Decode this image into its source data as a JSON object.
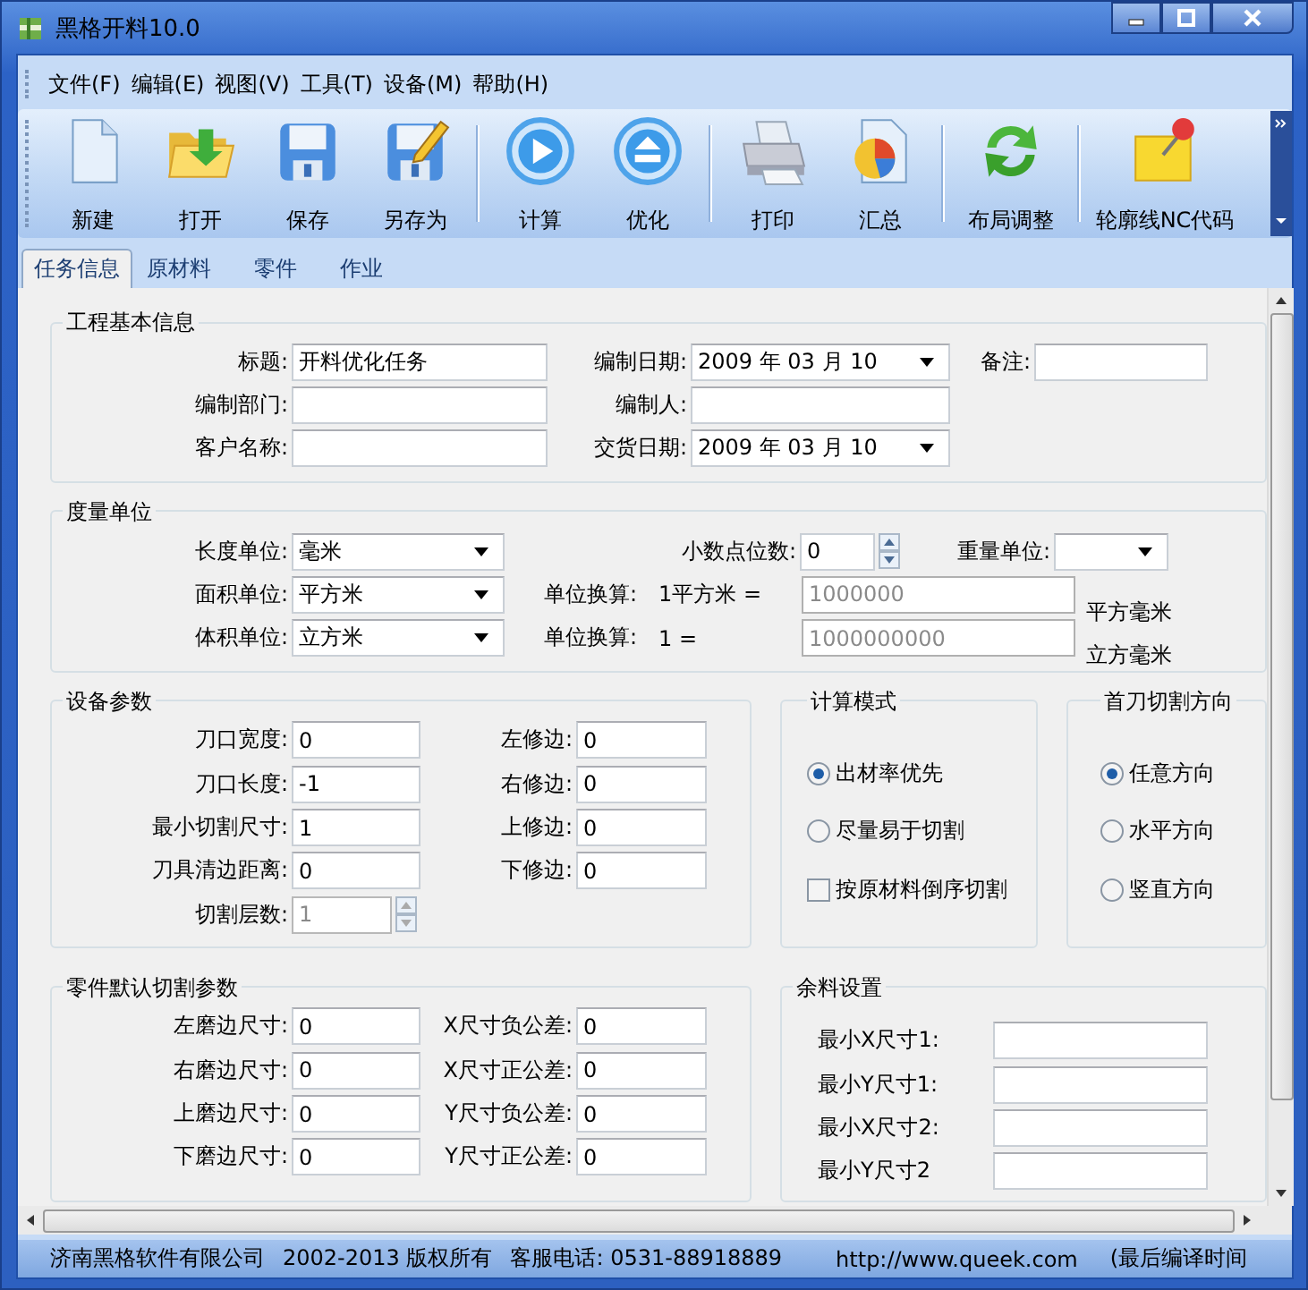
{
  "window": {
    "title": "黑格开料10.0"
  },
  "menu": [
    "文件(F)",
    "编辑(E)",
    "视图(V)",
    "工具(T)",
    "设备(M)",
    "帮助(H)"
  ],
  "toolbar": [
    [
      {
        "label": "新建",
        "kind": "new"
      },
      {
        "label": "打开",
        "kind": "open"
      },
      {
        "label": "保存",
        "kind": "save"
      },
      {
        "label": "另存为",
        "kind": "save_as"
      }
    ],
    [
      {
        "label": "计算",
        "kind": "calculate"
      },
      {
        "label": "优化",
        "kind": "optimize"
      }
    ],
    [
      {
        "label": "打印",
        "kind": "print"
      },
      {
        "label": "汇总",
        "kind": "summary"
      }
    ],
    [
      {
        "label": "布局调整",
        "kind": "layout"
      }
    ],
    [
      {
        "label": "轮廓线NC代码",
        "kind": "nc"
      }
    ]
  ],
  "tabs": [
    {
      "label": "任务信息",
      "selected": true
    },
    {
      "label": "原材料",
      "selected": false
    },
    {
      "label": "零件",
      "selected": false
    },
    {
      "label": "作业",
      "selected": false
    }
  ],
  "project_info": {
    "title": "工程基本信息",
    "rows": [
      [
        {
          "label": "标题:",
          "kind": "text",
          "value": "开料优化任务"
        },
        {
          "label": "编制日期:",
          "kind": "date",
          "value": "2009 年 03 月 10"
        },
        {
          "label": "备注:",
          "kind": "text"
        }
      ],
      [
        {
          "label": "编制部门:",
          "kind": "text"
        },
        {
          "label": "编制人:",
          "kind": "text"
        }
      ],
      [
        {
          "label": "客户名称:",
          "kind": "text"
        },
        {
          "label": "交货日期:",
          "kind": "date",
          "value": "2009 年 03 月 10"
        }
      ]
    ]
  },
  "units": {
    "title": "度量单位",
    "rows": [
      [
        {
          "label": "长度单位:",
          "kind": "select",
          "value": "毫米"
        },
        {
          "label": "小数点位数:",
          "kind": "spin",
          "value": "0",
          "disabled": false
        },
        {
          "label": "重量单位:",
          "kind": "select"
        }
      ],
      [
        {
          "label": "面积单位:",
          "kind": "select",
          "value": "平方米"
        },
        {
          "label": "单位换算:",
          "kind": "conversion",
          "prefix": "1平方米 =",
          "value": "1000000",
          "suffix": "平方毫米"
        }
      ],
      [
        {
          "label": "体积单位:",
          "kind": "select",
          "value": "立方米"
        },
        {
          "label": "单位换算:",
          "kind": "conversion",
          "prefix": "1 =",
          "value": "1000000000",
          "suffix": "立方毫米"
        }
      ]
    ]
  },
  "equipment": {
    "title": "设备参数",
    "rows": [
      [
        {
          "label": "刀口宽度:",
          "kind": "text",
          "value": "0"
        },
        {
          "label": "左修边:",
          "kind": "text",
          "value": "0"
        }
      ],
      [
        {
          "label": "刀口长度:",
          "kind": "text",
          "value": "-1"
        },
        {
          "label": "右修边:",
          "kind": "text",
          "value": "0"
        }
      ],
      [
        {
          "label": "最小切割尺寸:",
          "kind": "text",
          "value": "1"
        },
        {
          "label": "上修边:",
          "kind": "text",
          "value": "0"
        }
      ],
      [
        {
          "label": "刀具清边距离:",
          "kind": "text",
          "value": "0"
        },
        {
          "label": "下修边:",
          "kind": "text",
          "value": "0"
        }
      ],
      [
        {
          "label": "切割层数:",
          "kind": "spin",
          "value": "1",
          "disabled": true
        }
      ]
    ]
  },
  "calc_mode": {
    "title": "计算模式",
    "options": [
      {
        "label": "出材率优先",
        "kind": "radio",
        "selected": true
      },
      {
        "label": "尽量易于切割",
        "kind": "radio",
        "selected": false
      },
      {
        "label": "按原材料倒序切割",
        "kind": "checkbox",
        "checked": false
      }
    ]
  },
  "first_cut": {
    "title": "首刀切割方向",
    "options": [
      {
        "label": "任意方向",
        "kind": "radio",
        "selected": true
      },
      {
        "label": "水平方向",
        "kind": "radio",
        "selected": false
      },
      {
        "label": "竖直方向",
        "kind": "radio",
        "selected": false
      }
    ]
  },
  "part_defaults": {
    "title": "零件默认切割参数",
    "rows": [
      [
        {
          "label": "左磨边尺寸:",
          "kind": "text",
          "value": "0"
        },
        {
          "label": "X尺寸负公差:",
          "kind": "text",
          "value": "0"
        }
      ],
      [
        {
          "label": "右磨边尺寸:",
          "kind": "text",
          "value": "0"
        },
        {
          "label": "X尺寸正公差:",
          "kind": "text",
          "value": "0"
        }
      ],
      [
        {
          "label": "上磨边尺寸:",
          "kind": "text",
          "value": "0"
        },
        {
          "label": "Y尺寸负公差:",
          "kind": "text",
          "value": "0"
        }
      ],
      [
        {
          "label": "下磨边尺寸:",
          "kind": "text",
          "value": "0"
        },
        {
          "label": "Y尺寸正公差:",
          "kind": "text",
          "value": "0"
        }
      ]
    ]
  },
  "leftover": {
    "title": "余料设置",
    "rows": [
      [
        {
          "label": "最小X尺寸1:",
          "kind": "text"
        }
      ],
      [
        {
          "label": "最小Y尺寸1:",
          "kind": "text"
        }
      ],
      [
        {
          "label": "最小X尺寸2:",
          "kind": "text"
        }
      ],
      [
        {
          "label": "最小Y尺寸2",
          "kind": "text"
        }
      ]
    ]
  },
  "status_bar": [
    "济南黑格软件有限公司",
    "2002-2013 版权所有",
    "客服电话: 0531-88918889",
    "http://www.queek.com",
    "(最后编译时间"
  ]
}
